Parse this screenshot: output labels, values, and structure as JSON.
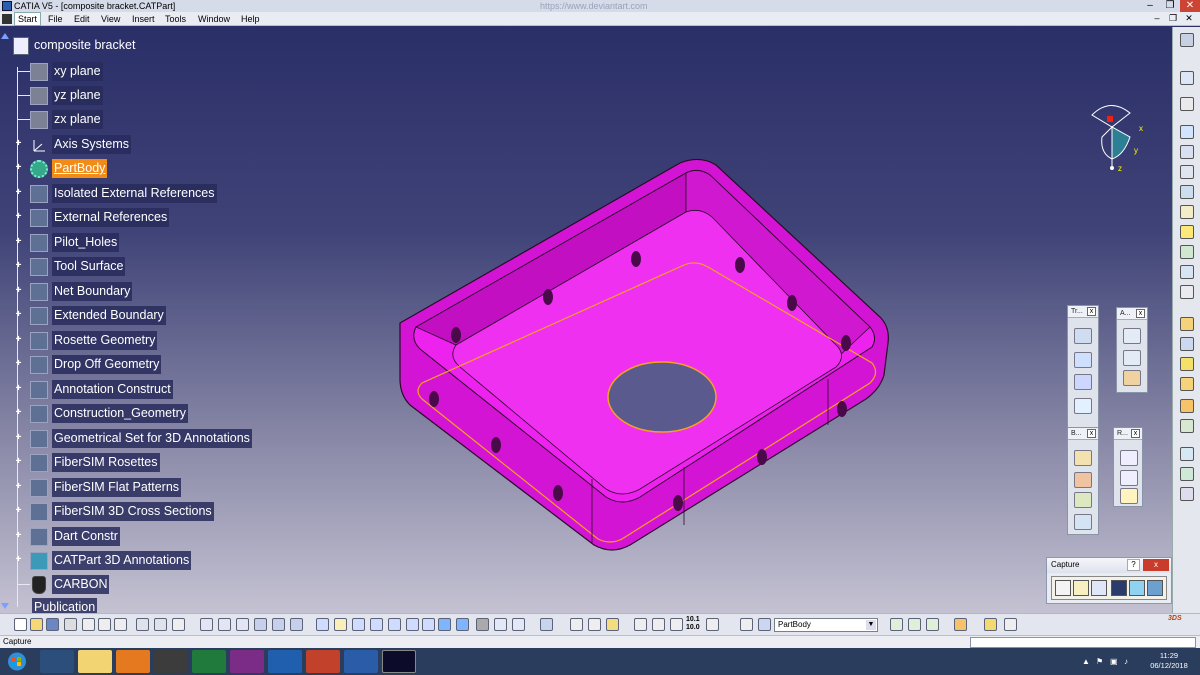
{
  "window": {
    "title": "CATIA V5 - [composite bracket.CATPart]",
    "dim_title": "https://www.deviantart.com"
  },
  "menu": {
    "items": [
      "Start",
      "File",
      "Edit",
      "View",
      "Insert",
      "Tools",
      "Window",
      "Help"
    ]
  },
  "tree": {
    "root": "composite bracket",
    "items": [
      {
        "label": "xy plane",
        "icon": "plane-icon"
      },
      {
        "label": "yz plane",
        "icon": "plane-icon"
      },
      {
        "label": "zx plane",
        "icon": "plane-icon"
      },
      {
        "label": "Axis Systems",
        "icon": "axis-system-icon"
      },
      {
        "label": "PartBody",
        "icon": "partbody-gear-icon"
      },
      {
        "label": "Isolated External References",
        "icon": "geometrical-set-icon"
      },
      {
        "label": "External References",
        "icon": "geometrical-set-icon"
      },
      {
        "label": "Pilot_Holes",
        "icon": "geometrical-set-icon"
      },
      {
        "label": "Tool Surface",
        "icon": "geometrical-set-icon"
      },
      {
        "label": "Net Boundary",
        "icon": "geometrical-set-icon"
      },
      {
        "label": "Extended Boundary",
        "icon": "geometrical-set-icon"
      },
      {
        "label": "Rosette Geometry",
        "icon": "geometrical-set-icon"
      },
      {
        "label": "Drop Off Geometry",
        "icon": "geometrical-set-icon"
      },
      {
        "label": "Annotation Construct",
        "icon": "geometrical-set-icon"
      },
      {
        "label": "Construction_Geometry",
        "icon": "geometrical-set-icon"
      },
      {
        "label": "Geometrical Set for 3D Annotations",
        "icon": "geometrical-set-icon"
      },
      {
        "label": "FiberSIM Rosettes",
        "icon": "geometrical-set-icon"
      },
      {
        "label": "FiberSIM Flat Patterns",
        "icon": "geometrical-set-icon"
      },
      {
        "label": "FiberSIM 3D Cross Sections",
        "icon": "geometrical-set-icon"
      },
      {
        "label": "Dart Constr",
        "icon": "geometrical-set-icon"
      },
      {
        "label": "CATPart 3D Annotations",
        "icon": "annotation-set-icon"
      },
      {
        "label": "CARBON",
        "icon": "material-icon"
      },
      {
        "label": "Publication",
        "icon": "publication-icon"
      }
    ],
    "selected": "PartBody"
  },
  "compass_labels": {
    "x": "x",
    "y": "y",
    "z": "z"
  },
  "floating_toolbars": [
    {
      "title": "Tr...",
      "id": "transformations"
    },
    {
      "title": "A...",
      "id": "annotations"
    },
    {
      "title": "B...",
      "id": "booleans"
    },
    {
      "title": "R...",
      "id": "reference"
    }
  ],
  "capture_toolbar": {
    "title": "Capture",
    "help": "?",
    "close": "x"
  },
  "bottom_toolbar": {
    "current_body": "PartBody",
    "zoom_labels": [
      "10.1",
      "10.0"
    ]
  },
  "status": {
    "text": "Capture"
  },
  "taskbar": {
    "time": "11:29",
    "date": "06/12/2018"
  },
  "colors": {
    "part": "#e81ce8",
    "highlight": "#f28c18",
    "viewport_top": "#2b2f68"
  }
}
